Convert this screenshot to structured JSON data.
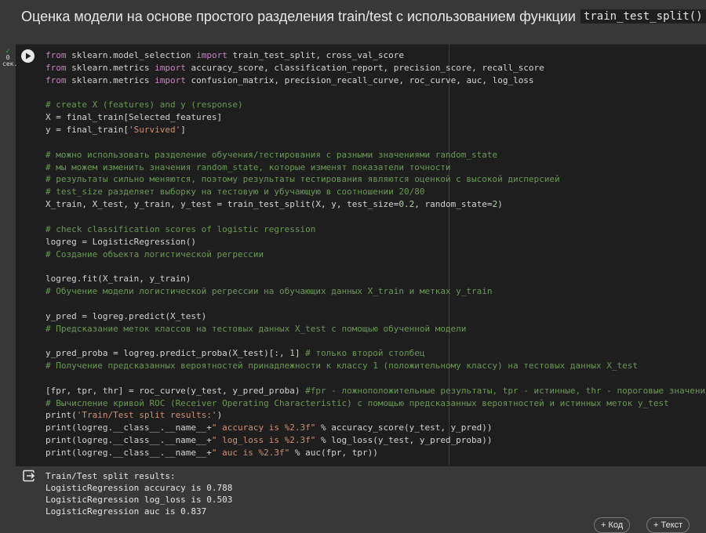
{
  "heading": {
    "text": "Оценка модели на основе простого разделения train/test с использованием функции",
    "code": "train_test_split()"
  },
  "cell_status": {
    "number": "0",
    "unit": "сек."
  },
  "code_lines": [
    [
      [
        "kw",
        "from"
      ],
      [
        "tx",
        " sklearn.model_selection "
      ],
      [
        "kw",
        "import"
      ],
      [
        "tx",
        " train_test_split, cross_val_score"
      ]
    ],
    [
      [
        "kw",
        "from"
      ],
      [
        "tx",
        " sklearn.metrics "
      ],
      [
        "kw",
        "import"
      ],
      [
        "tx",
        " accuracy_score, classification_report, precision_score, recall_score"
      ]
    ],
    [
      [
        "kw",
        "from"
      ],
      [
        "tx",
        " sklearn.metrics "
      ],
      [
        "kw",
        "import"
      ],
      [
        "tx",
        " confusion_matrix, precision_recall_curve, roc_curve, auc, log_loss"
      ]
    ],
    [],
    [
      [
        "cm",
        "# create X (features) and y (response)"
      ]
    ],
    [
      [
        "tx",
        "X = final_train[Selected_features]"
      ]
    ],
    [
      [
        "tx",
        "y = final_train["
      ],
      [
        "st",
        "'Survived'"
      ],
      [
        "tx",
        "]"
      ]
    ],
    [],
    [
      [
        "cm",
        "# можно использовать разделение обучения/тестирования с разными значениями random_state"
      ]
    ],
    [
      [
        "cm",
        "# мы можем изменить значения random_state, которые изменят показатели точности"
      ]
    ],
    [
      [
        "cm",
        "# результаты сильно меняются, поэтому результаты тестирования являются оценкой с высокой дисперсией"
      ]
    ],
    [
      [
        "cm",
        "# test_size разделяет выборку на тестовую и убучающую в соотношении 20/80"
      ]
    ],
    [
      [
        "tx",
        "X_train, X_test, y_train, y_test = train_test_split(X, y, test_size="
      ],
      [
        "nu",
        "0.2"
      ],
      [
        "tx",
        ", random_state="
      ],
      [
        "nu",
        "2"
      ],
      [
        "tx",
        ")"
      ]
    ],
    [],
    [
      [
        "cm",
        "# check classification scores of logistic regression"
      ]
    ],
    [
      [
        "tx",
        "logreg = LogisticRegression()"
      ]
    ],
    [
      [
        "cm",
        "# Создание объекта логистической регрессии"
      ]
    ],
    [],
    [
      [
        "tx",
        "logreg.fit(X_train, y_train)"
      ]
    ],
    [
      [
        "cm",
        "# Обучение модели логистической регрессии на обучающих данных X_train и метках y_train"
      ]
    ],
    [],
    [
      [
        "tx",
        "y_pred = logreg.predict(X_test)"
      ]
    ],
    [
      [
        "cm",
        "# Предсказание меток классов на тестовых данных X_test с помощью обученной модели"
      ]
    ],
    [],
    [
      [
        "tx",
        "y_pred_proba = logreg.predict_proba(X_test)[:, "
      ],
      [
        "nu",
        "1"
      ],
      [
        "tx",
        "] "
      ],
      [
        "cm",
        "# только второй столбец"
      ]
    ],
    [
      [
        "cm",
        "# Получение предсказанных вероятностей принадлежности к классу 1 (положительному классу) на тестовых данных X_test"
      ]
    ],
    [],
    [
      [
        "tx",
        "[fpr, tpr, thr] = roc_curve(y_test, y_pred_proba) "
      ],
      [
        "cm",
        "#fpr - ложноположительные результаты, tpr - истинные, thr - пороговые значения"
      ]
    ],
    [
      [
        "cm",
        "# Вычисление кривой ROC (Receiver Operating Characteristic) с помощью предсказанных вероятностей и истинных меток y_test"
      ]
    ],
    [
      [
        "tx",
        "print("
      ],
      [
        "st",
        "'Train/Test split results:'"
      ],
      [
        "tx",
        ")"
      ]
    ],
    [
      [
        "tx",
        "print(logreg.__class__.__name__+"
      ],
      [
        "st",
        "\" accuracy is %2.3f\""
      ],
      [
        "tx",
        " % accuracy_score(y_test, y_pred))"
      ]
    ],
    [
      [
        "tx",
        "print(logreg.__class__.__name__+"
      ],
      [
        "st",
        "\" log_loss is %2.3f\""
      ],
      [
        "tx",
        " % log_loss(y_test, y_pred_proba))"
      ]
    ],
    [
      [
        "tx",
        "print(logreg.__class__.__name__+"
      ],
      [
        "st",
        "\" auc is %2.3f\""
      ],
      [
        "tx",
        " % auc(fpr, tpr))"
      ]
    ]
  ],
  "output_lines": [
    "Train/Test split results:",
    "LogisticRegression accuracy is 0.788",
    "LogisticRegression log_loss is 0.503",
    "LogisticRegression auc is 0.837"
  ],
  "add_buttons": {
    "code_label": "+ Код",
    "text_label": "+ Текст"
  },
  "colors": {
    "keyword": "#c586c0",
    "comment": "#6a9955",
    "string": "#ce9178",
    "number": "#b5cea8"
  },
  "icons": {
    "run": "play-circle-icon",
    "output": "output-redirect-icon",
    "status": "check-icon"
  }
}
